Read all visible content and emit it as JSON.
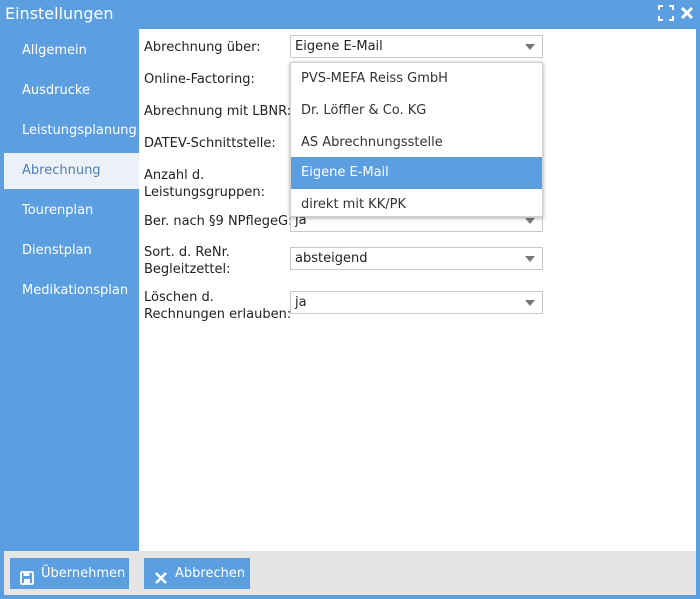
{
  "window": {
    "title": "Einstellungen"
  },
  "sidebar": {
    "items": [
      {
        "label": "Allgemein"
      },
      {
        "label": "Ausdrucke"
      },
      {
        "label": "Leistungsplanung"
      },
      {
        "label": "Abrechnung",
        "active": true
      },
      {
        "label": "Tourenplan"
      },
      {
        "label": "Dienstplan"
      },
      {
        "label": "Medikationsplan"
      }
    ]
  },
  "form": {
    "abrechnung_ueber": {
      "label": "Abrechnung über:",
      "value": "Eigene E-Mail"
    },
    "online_factoring": {
      "label": "Online-Factoring:"
    },
    "abrechnung_lbnr": {
      "label": "Abrechnung mit LBNR:"
    },
    "datev": {
      "label": "DATEV-Schnittstelle:"
    },
    "anzahl_line1": "Anzahl d.",
    "anzahl_line2": "Leistungsgruppen:",
    "ber_npflegeg": {
      "label": "Ber. nach §9 NPflegeG:",
      "value": "ja"
    },
    "sort_line1": "Sort. d. ReNr.",
    "sort_line2": "Begleitzettel:",
    "sort_value": "absteigend",
    "loeschen_line1": "Löschen d.",
    "loeschen_line2": "Rechnungen erlauben:",
    "loeschen_value": "ja"
  },
  "dropdown": {
    "options": [
      {
        "label": "PVS-MEFA Reiss GmbH"
      },
      {
        "label": "Dr. Löffler & Co. KG"
      },
      {
        "label": "AS Abrechnungsstelle"
      },
      {
        "label": "Eigene E-Mail",
        "selected": true
      },
      {
        "label": "direkt mit KK/PK"
      }
    ]
  },
  "footer": {
    "apply_label": "Übernehmen",
    "cancel_label": "Abbrechen"
  },
  "colors": {
    "accent": "#5c9fe0",
    "sidebar_active_bg": "#ecf1f7",
    "sidebar_active_text": "#4f7fb4",
    "footer_bg": "#e5e5e5"
  }
}
